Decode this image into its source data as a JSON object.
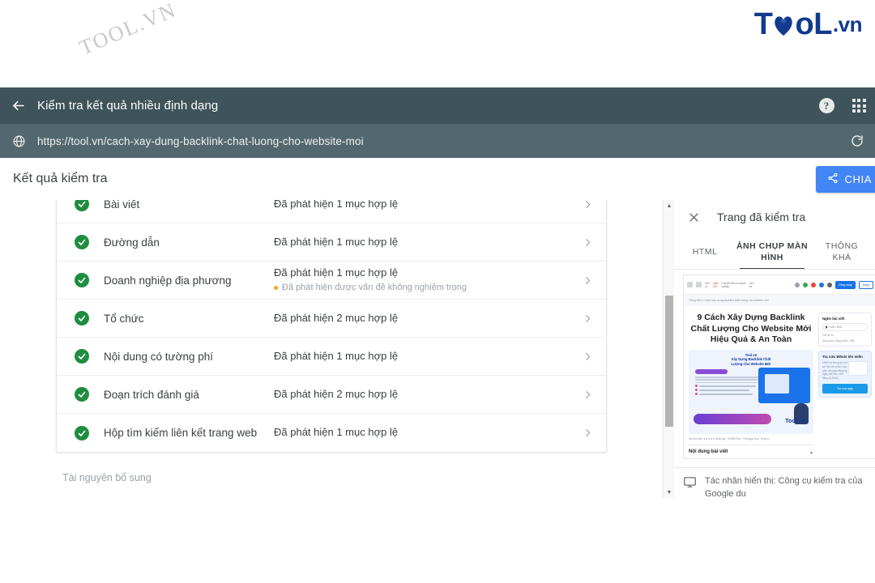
{
  "brand": {
    "logo_text_1": "T",
    "logo_mark": "leaf-heart-mark",
    "logo_text_2": "oL",
    "logo_suffix": ".vn",
    "logo_color": "#123a8f",
    "watermark": "TOOL.VN"
  },
  "appbar": {
    "back_icon": "arrow-left-icon",
    "title": "Kiểm tra kết quả nhiều định dạng",
    "help_icon": "help-circle-icon",
    "help_glyph": "?",
    "apps_icon": "apps-grid-icon",
    "background": "#3e535a"
  },
  "urlbar": {
    "globe_icon": "globe-icon",
    "url": "https://tool.vn/cach-xay-dung-backlink-chat-luong-cho-website-moi",
    "reload_icon": "reload-icon",
    "background": "#53686e"
  },
  "results_header": {
    "title": "Kết quả kiểm tra",
    "share_icon": "share-icon",
    "share_label": "CHIA",
    "share_color": "#4285f4"
  },
  "results": {
    "rows": [
      {
        "name": "Bài viết",
        "status": "Đã phát hiện 1 mục hợp lệ",
        "warning": "",
        "icon": "check-circle-icon",
        "chevron": "chevron-right-icon"
      },
      {
        "name": "Đường dẫn",
        "status": "Đã phát hiện 1 mục hợp lệ",
        "warning": "",
        "icon": "check-circle-icon",
        "chevron": "chevron-right-icon"
      },
      {
        "name": "Doanh nghiệp địa phương",
        "status": "Đã phát hiện 1 mục hợp lệ",
        "warning": "Đã phát hiện được vấn đề không nghiêm trọng",
        "icon": "check-circle-icon",
        "chevron": "chevron-right-icon"
      },
      {
        "name": "Tổ chức",
        "status": "Đã phát hiện 2 mục hợp lệ",
        "warning": "",
        "icon": "check-circle-icon",
        "chevron": "chevron-right-icon"
      },
      {
        "name": "Nội dung có tường phí",
        "status": "Đã phát hiện 1 mục hợp lệ",
        "warning": "",
        "icon": "check-circle-icon",
        "chevron": "chevron-right-icon"
      },
      {
        "name": "Đoạn trích đánh giá",
        "status": "Đã phát hiện 2 mục hợp lệ",
        "warning": "",
        "icon": "check-circle-icon",
        "chevron": "chevron-right-icon"
      },
      {
        "name": "Hộp tìm kiếm liên kết trang web",
        "status": "Đã phát hiện 1 mục hợp lệ",
        "warning": "",
        "icon": "check-circle-icon",
        "chevron": "chevron-right-icon"
      }
    ],
    "extra_resources_label": "Tài nguyên bổ sung",
    "valid_color": "#1e8e3e",
    "warning_color": "#f5a623"
  },
  "preview_panel": {
    "close_icon": "close-icon",
    "title": "Trang đã kiểm tra",
    "tabs": [
      {
        "label": "HTML",
        "active": false
      },
      {
        "label": "ẢNH CHỤP MÀN HÌNH",
        "active": true
      },
      {
        "label": "THÔNG\nKHÁ",
        "active": false
      }
    ],
    "agent_icon": "desktop-monitor-icon",
    "agent_text": "Tác nhân hiển thị: Công cụ kiểm tra của Google du\nmáy tính"
  },
  "screenshot_preview": {
    "browser_chrome": {
      "menu_icon": "hamburger-icon",
      "search_icon": "search-icon",
      "nav_items": [
        "Dịch\nvụ",
        "Liệu\nDữ",
        "Chuyển đổi số doanh\nnghiệp",
        "Liên\nhệ"
      ],
      "signin_button": "Đăng nhập",
      "register_button": "Đăng"
    },
    "breadcrumb": "/ Blog SEO / Cách xây dựng backlink chất lượng cho website mới",
    "headline": "9 Cách Xây Dựng Backlink Chất Lượng Cho Website Mới Hiệu Quả & An Toàn",
    "hero_title": "Tool.vn\nXây Dựng Backlink Chất\nLượng Cho Website Mới",
    "hero_logo": "TooL.vn",
    "meta_line": "46 lượt xem ★★★★★ đánh giá · 20/09/2024 · Thời gian đọc: 18 phút",
    "toc_label": "Nội dung bài viết",
    "sidebar_cards": [
      {
        "title": "Nghe bài viết",
        "sub": "0:00 / 0:00",
        "row1": "Tốc độ  1x",
        "row2": "Giọng đọc  Giọng Nam - Bắc"
      },
      {
        "title": "Tra cứu Whois tên miền",
        "text": "Kiểm tra thông tin chủ sở hữu tên miền, bao gồm cả ngày đăng ký, ngày hết hạn, nhà đăng ký DNS...",
        "button": "Tra cứu ngay"
      }
    ]
  }
}
